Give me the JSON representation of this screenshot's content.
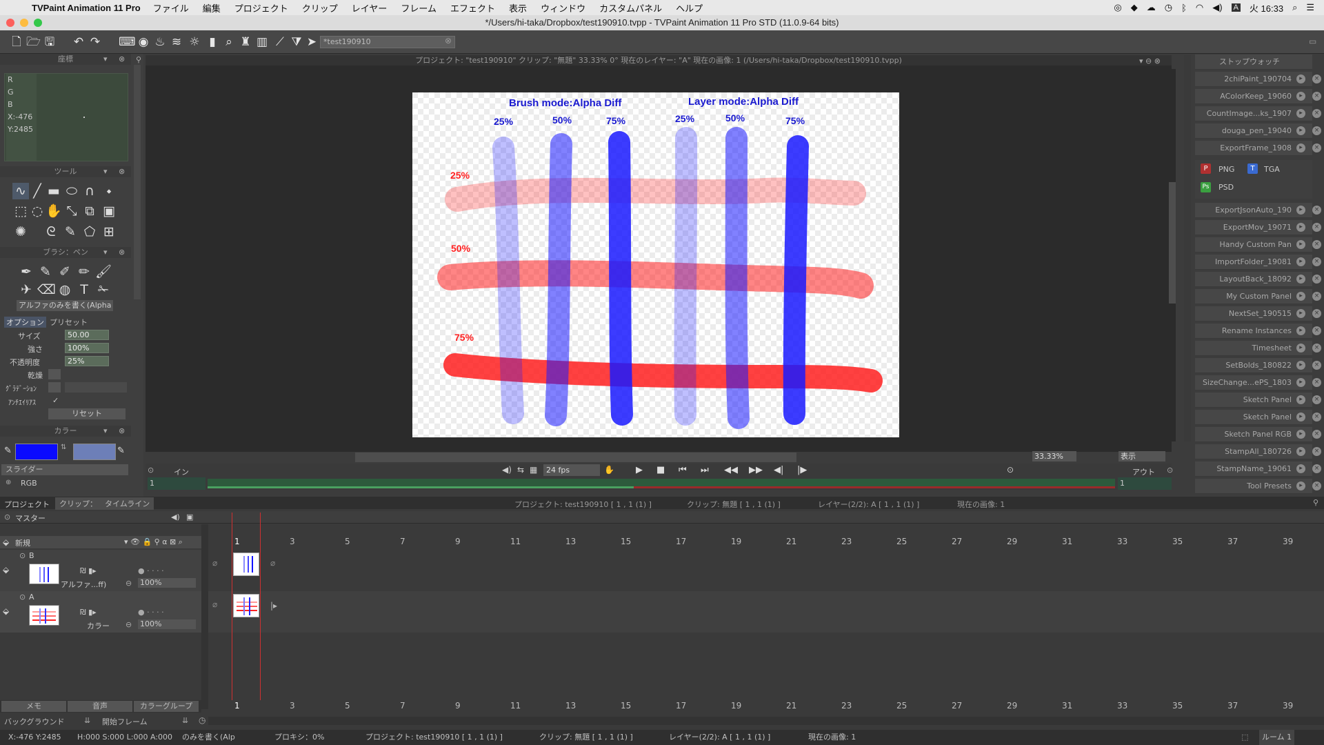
{
  "menubar": {
    "app_name": "TVPaint Animation 11 Pro",
    "items": [
      "ファイル",
      "編集",
      "プロジェクト",
      "クリップ",
      "レイヤー",
      "フレーム",
      "エフェクト",
      "表示",
      "ウィンドウ",
      "カスタムパネル",
      "ヘルプ"
    ],
    "clock": "火 16:33",
    "input_mode": "A"
  },
  "window": {
    "title": "*/Users/hi-taka/Dropbox/test190910.tvpp - TVPaint Animation 11 Pro STD (11.0.9-64 bits)"
  },
  "toolbar": {
    "search_value": "*test190910"
  },
  "info_bar": "プロジェクト: \"test190910\"  クリップ: \"無題\"   33.33%   0°  現在のレイヤー: \"A\"  現在の画像: 1  (/Users/hi-taka/Dropbox/test190910.tvpp)",
  "coords_panel": {
    "title": "座標",
    "labels": [
      "R",
      "G",
      "B"
    ],
    "x": "X:-476",
    "y": "Y:2485"
  },
  "tools_panel": {
    "title": "ツール"
  },
  "brush_panel": {
    "title": "ブラシ：ペン",
    "mode": "アルファのみを書く(Alpha",
    "tab_option": "オプション",
    "tab_preset": "プリセット",
    "size_label": "サイズ",
    "size_value": "50.00",
    "strength_label": "強さ",
    "strength_value": "100%",
    "opacity_label": "不透明度",
    "opacity_value": "25%",
    "dry_label": "乾燥",
    "gradation_label": "ｸﾞﾗﾃﾞｰｼｮﾝ",
    "antialias_label": "ｱﾝﾁｴｲﾘｱｽ",
    "antialias_check": "✓",
    "reset_label": "リセット"
  },
  "color_panel": {
    "title": "カラー",
    "primary": "#0a0aff",
    "secondary": "#6d7fb8",
    "slider_title": "スライダー",
    "slider_mode": "RGB"
  },
  "canvas": {
    "brush_header": "Brush mode:Alpha Diff",
    "layer_header": "Layer mode:Alpha Diff",
    "col_labels": [
      "25%",
      "50%",
      "75%",
      "25%",
      "50%",
      "75%"
    ],
    "row_labels": [
      "25%",
      "50%",
      "75%"
    ],
    "blue": "#1a1aff",
    "red": "#ff2020"
  },
  "playback": {
    "in_label": "イン",
    "out_label": "アウト",
    "fps": "24 fps",
    "zoom": "33.33%",
    "view_label": "表示",
    "in_value": "1",
    "out_value": "1"
  },
  "right_panel": {
    "stopwatch": "ストップウォッチ",
    "items_top": [
      "2chiPaint_190704",
      "AColorKeep_19060",
      "CountImage...ks_1907",
      "douga_pen_19040",
      "ExportFrame_1908"
    ],
    "export_formats": [
      "PNG",
      "TGA",
      "PSD"
    ],
    "items_bottom": [
      "ExportJsonAuto_190",
      "ExportMov_19071",
      "Handy Custom Pan",
      "ImportFolder_19081",
      "LayoutBack_18092",
      "My Custom Panel",
      "NextSet_190515",
      "Rename Instances",
      "Timesheet",
      "SetBolds_180822",
      "SizeChange...ePS_1803",
      "Sketch Panel",
      "Sketch Panel",
      "Sketch Panel RGB",
      "StampAll_180726",
      "StampName_19061",
      "Tool Presets"
    ]
  },
  "timeline": {
    "tab_project": "プロジェクト",
    "tab_clip": "クリップ：",
    "tab_timeline": "タイムライン",
    "info_project": "プロジェクト: test190910 [ 1 , 1  (1) ]",
    "info_clip": "クリップ: 無題 [ 1 , 1  (1) ]",
    "info_layer": "レイヤー(2/2): A [ 1 , 1  (1) ]",
    "info_image": "現在の画像: 1",
    "master": "マスター",
    "new_layer": "新規",
    "frames": [
      "1",
      "3",
      "5",
      "7",
      "9",
      "11",
      "13",
      "15",
      "17",
      "19",
      "21",
      "23",
      "25",
      "27",
      "29",
      "31",
      "33",
      "35",
      "37",
      "39"
    ],
    "layers": [
      {
        "name": "B",
        "mode": "アルファ...ff)",
        "opacity": "100%"
      },
      {
        "name": "A",
        "mode": "カラー",
        "opacity": "100%"
      }
    ],
    "bottom_tabs": [
      "メモ",
      "音声",
      "カラーグループ"
    ],
    "background": "バックグラウンド",
    "start_frame": "開始フレーム"
  },
  "status": {
    "coords": "X:-476  Y:2485",
    "hsl": "H:000 S:000 L:000 A:000",
    "mode": "のみを書く(Alp",
    "proxy": "プロキシ：0%",
    "project": "プロジェクト: test190910 [ 1 , 1  (1) ]",
    "clip": "クリップ: 無題 [ 1 , 1  (1) ]",
    "layer": "レイヤー(2/2): A [ 1 , 1  (1) ]",
    "image": "現在の画像: 1",
    "room": "ルーム 1"
  }
}
